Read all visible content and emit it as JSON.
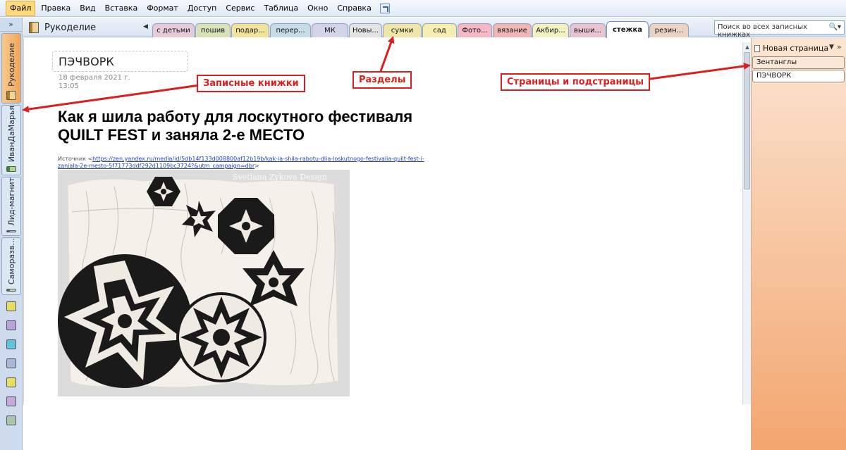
{
  "menu": [
    "Файл",
    "Правка",
    "Вид",
    "Вставка",
    "Формат",
    "Доступ",
    "Сервис",
    "Таблица",
    "Окно",
    "Справка"
  ],
  "notebook_title": "Рукоделие",
  "left_nav": {
    "collapse": "»",
    "notebooks": [
      "Рукоделие",
      "ИванДаМарья",
      "Лид-магнит",
      "Саморазв..."
    ]
  },
  "tabs": [
    "с детьми",
    "пошив",
    "подар...",
    "перер...",
    "МК",
    "Новы...",
    "сумки",
    "сад",
    "Фото...",
    "вязание",
    "Акбир...",
    "выши...",
    "стежка",
    "резин..."
  ],
  "active_tab": "стежка",
  "tab_colors": [
    "#e6ccd9",
    "#d7e2b8",
    "#f1e39b",
    "#c7dbe9",
    "#d3d3eb",
    "#e3e3e3",
    "#efe6a9",
    "#f6efb0",
    "#f6b8c4",
    "#f0b6b6",
    "#f1f2c0",
    "#e9c3cf",
    "#ffffff",
    "#ebd2c4"
  ],
  "search": {
    "placeholder": "Поиск во всех записных книжках"
  },
  "page": {
    "title": "ПЭЧВОРК",
    "date": "18 февраля 2021 г.",
    "time": "13:05",
    "heading": "Как я шила работу для лоскутного фестиваля QUILT FEST и заняла 2-е МЕСТО",
    "source_label": "Источник <",
    "source_url": "https://zen.yandex.ru/media/id/5db14f133d008800af12b19b/kak-ia-shila-rabotu-dlia-loskutnogo-festivalia-quilt-fest-i-zaniala-2e-mesto-5f71773ddf292d1109bc3724?&utm_campaign=dbr",
    "source_end": ">",
    "watermark": "Svetlana Zykova Design"
  },
  "page_list": {
    "new_page": "Новая страница",
    "more": "»",
    "items": [
      "Зентанглы",
      "ПЭЧВОРК"
    ]
  },
  "annotations": {
    "notebooks": "Записные книжки",
    "sections": "Разделы",
    "pages": "Страницы и подстраницы"
  },
  "accent": "#d91f1f"
}
